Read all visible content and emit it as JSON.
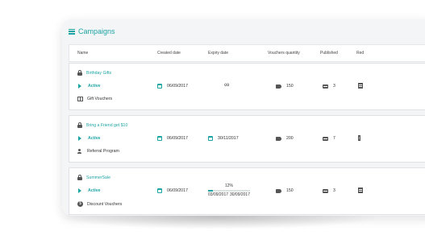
{
  "header": {
    "title": "Campaigns",
    "icon": "list-icon"
  },
  "columns": [
    "Name",
    "Created date",
    "Expiry date",
    "Vouchers quantity",
    "Published",
    "Red"
  ],
  "accent_color": "#1fa4a4",
  "rows": [
    {
      "name": "Birthday Gifts",
      "status": "Active",
      "type": "Gift Vouchers",
      "type_icon": "gift-icon",
      "created": "06/09/2017",
      "expiry": "∞",
      "quantity": "150",
      "published": "3"
    },
    {
      "name": "Bring a Friend get $10",
      "status": "Active",
      "type": "Referral Program",
      "type_icon": "referral-icon",
      "created": "06/09/2017",
      "expiry": "30/11/2017",
      "quantity": "200",
      "published": "7"
    },
    {
      "name": "SummerSale",
      "status": "Active",
      "type": "Discount Vouchers",
      "type_icon": "discount-icon",
      "created": "06/09/2017",
      "progress_label": "12%",
      "progress": 0.12,
      "progress_start": "03/09/2017",
      "progress_end": "30/09/2017",
      "quantity": "150",
      "published": "3"
    }
  ]
}
